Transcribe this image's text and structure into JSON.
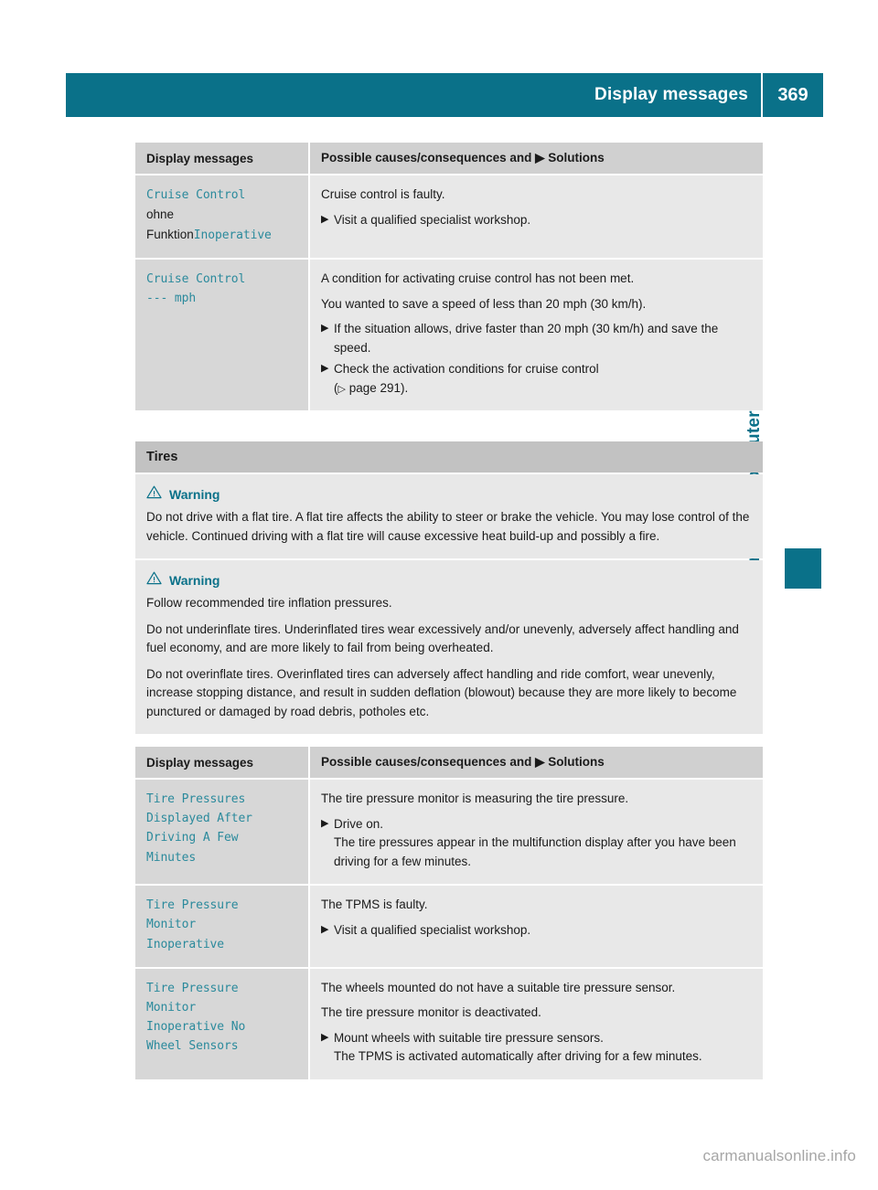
{
  "header": {
    "title": "Display messages",
    "page_number": "369"
  },
  "side_tab": {
    "label": "On-board computer and displays"
  },
  "footer": {
    "watermark": "carmanualsonline.info"
  },
  "table_headers": {
    "col1": "Display messages",
    "col2_pre": "Possible causes/consequences and",
    "col2_post": "Solutions",
    "solution_marker": "▶"
  },
  "table1": {
    "rows": [
      {
        "message_lines": [
          {
            "text": "Cruise Control",
            "style": "mono"
          },
          {
            "text": "ohne",
            "style": "plain"
          },
          {
            "text": "Funktion",
            "style": "plain",
            "suffix": "Inoperative",
            "suffix_style": "mono"
          }
        ],
        "paragraphs": [
          "Cruise control is faulty."
        ],
        "bullets": [
          {
            "text": "Visit a qualified specialist workshop.",
            "sub": []
          }
        ]
      },
      {
        "message_lines": [
          {
            "text": "Cruise Control",
            "style": "mono"
          },
          {
            "text": "--- mph",
            "style": "mono"
          }
        ],
        "paragraphs": [
          "A condition for activating cruise control has not been met.",
          "You wanted to save a speed of less than 20 mph (30 km/h)."
        ],
        "bullets": [
          {
            "text": "If the situation allows, drive faster than 20 mph (30 km/h) and save the speed.",
            "sub": []
          },
          {
            "text": "Check the activation conditions for cruise control",
            "xref": "page 291",
            "xref_suffix": ")."
          }
        ]
      }
    ]
  },
  "section": {
    "title": "Tires"
  },
  "warnings": [
    {
      "label": "Warning",
      "icon": "warning-triangle-icon",
      "paragraphs": [
        "Do not drive with a flat tire. A flat tire affects the ability to steer or brake the vehicle. You may lose control of the vehicle. Continued driving with a flat tire will cause excessive heat build-up and possibly a fire."
      ]
    },
    {
      "label": "Warning",
      "icon": "warning-triangle-icon",
      "paragraphs": [
        "Follow recommended tire inflation pressures.",
        "Do not underinflate tires. Underinflated tires wear excessively and/or unevenly, adversely affect handling and fuel economy, and are more likely to fail from being overheated.",
        "Do not overinflate tires. Overinflated tires can adversely affect handling and ride comfort, wear unevenly, increase stopping distance, and result in sudden deflation (blowout) because they are more likely to become punctured or damaged by road debris, potholes etc."
      ]
    }
  ],
  "table2": {
    "rows": [
      {
        "message_lines": [
          {
            "text": "Tire Pressures",
            "style": "mono"
          },
          {
            "text": "Displayed After",
            "style": "mono"
          },
          {
            "text": "Driving A Few",
            "style": "mono"
          },
          {
            "text": "Minutes",
            "style": "mono"
          }
        ],
        "paragraphs": [
          "The tire pressure monitor is measuring the tire pressure."
        ],
        "bullets": [
          {
            "text": "Drive on.",
            "sub": [
              "The tire pressures appear in the multifunction display after you have been driving for a few minutes."
            ]
          }
        ]
      },
      {
        "message_lines": [
          {
            "text": "Tire Pressure",
            "style": "mono"
          },
          {
            "text": "Monitor",
            "style": "mono"
          },
          {
            "text": "Inoperative",
            "style": "mono"
          }
        ],
        "paragraphs": [
          "The TPMS is faulty."
        ],
        "bullets": [
          {
            "text": "Visit a qualified specialist workshop.",
            "sub": []
          }
        ]
      },
      {
        "message_lines": [
          {
            "text": "Tire Pressure",
            "style": "mono"
          },
          {
            "text": "Monitor",
            "style": "mono"
          },
          {
            "text": "Inoperative No",
            "style": "mono"
          },
          {
            "text": "Wheel Sensors",
            "style": "mono"
          }
        ],
        "paragraphs": [
          "The wheels mounted do not have a suitable tire pressure sensor.",
          "The tire pressure monitor is deactivated."
        ],
        "bullets": [
          {
            "text": "Mount wheels with suitable tire pressure sensors.",
            "sub": [
              "The TPMS is activated automatically after driving for a few minutes."
            ]
          }
        ]
      }
    ]
  },
  "colors": {
    "accent_teal": "#0a7189",
    "mono_teal": "#2b8a9c",
    "header_gray": "#d0d0d0",
    "left_cell_gray": "#d7d7d7",
    "right_cell_gray": "#e8e8e8",
    "section_gray": "#c2c2c2"
  }
}
